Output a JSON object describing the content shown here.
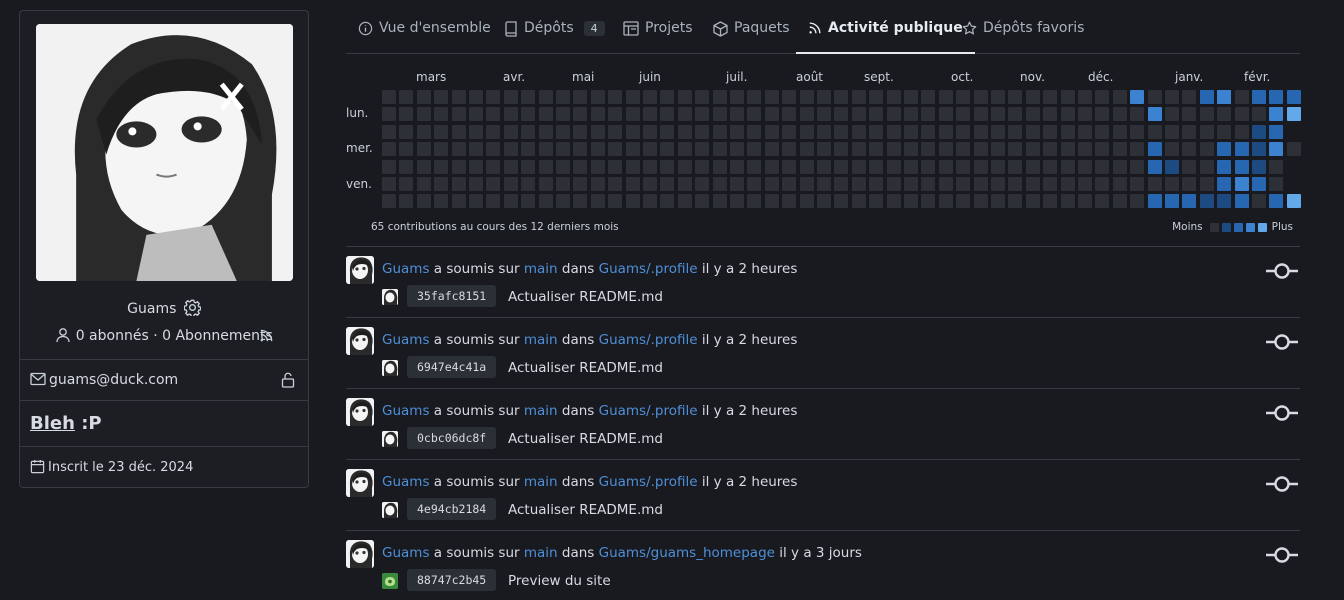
{
  "profile": {
    "username": "Guams",
    "followers": "0 abonnés · 0 Abonnements",
    "email": "guams@duck.com",
    "bio_link": "Bleh",
    "bio_rest": " :P",
    "joined": "Inscrit le 23 déc. 2024"
  },
  "tabs": [
    {
      "label": "Vue d'ensemble",
      "icon": "info-icon"
    },
    {
      "label": "Dépôts",
      "icon": "repo-icon",
      "count": "4"
    },
    {
      "label": "Projets",
      "icon": "project-icon"
    },
    {
      "label": "Paquets",
      "icon": "package-icon"
    },
    {
      "label": "Activité publique",
      "icon": "rss-icon",
      "active": true
    },
    {
      "label": "Dépôts favoris",
      "icon": "star-icon"
    }
  ],
  "heatmap": {
    "months": [
      "mars",
      "avr.",
      "mai",
      "juin",
      "juil.",
      "août",
      "sept.",
      "oct.",
      "nov.",
      "déc.",
      "janv.",
      "févr."
    ],
    "days": [
      "lun.",
      "mer.",
      "ven."
    ],
    "summary": "65 contributions au cours des 12 derniers mois",
    "legend_less": "Moins",
    "legend_more": "Plus",
    "colors": [
      "#2d3036",
      "#1d4a80",
      "#2766b0",
      "#3b82d1",
      "#63a8e8"
    ]
  },
  "feed": [
    {
      "user": "Guams",
      "verb": " a soumis sur ",
      "branch": "main",
      "in": " dans ",
      "repo": "Guams/.profile",
      "time": " il y a 2 heures",
      "sha": "35fafc8151",
      "message": "Actualiser README.md"
    },
    {
      "user": "Guams",
      "verb": " a soumis sur ",
      "branch": "main",
      "in": " dans ",
      "repo": "Guams/.profile",
      "time": " il y a 2 heures",
      "sha": "6947e4c41a",
      "message": "Actualiser README.md"
    },
    {
      "user": "Guams",
      "verb": " a soumis sur ",
      "branch": "main",
      "in": " dans ",
      "repo": "Guams/.profile",
      "time": " il y a 2 heures",
      "sha": "0cbc06dc8f",
      "message": "Actualiser README.md"
    },
    {
      "user": "Guams",
      "verb": " a soumis sur ",
      "branch": "main",
      "in": " dans ",
      "repo": "Guams/.profile",
      "time": " il y a 2 heures",
      "sha": "4e94cb2184",
      "message": "Actualiser README.md"
    },
    {
      "user": "Guams",
      "verb": " a soumis sur ",
      "branch": "main",
      "in": " dans ",
      "repo": "Guams/guams_homepage",
      "time": " il y a 3 jours",
      "sha": "88747c2b45",
      "message": "Preview du site"
    }
  ]
}
